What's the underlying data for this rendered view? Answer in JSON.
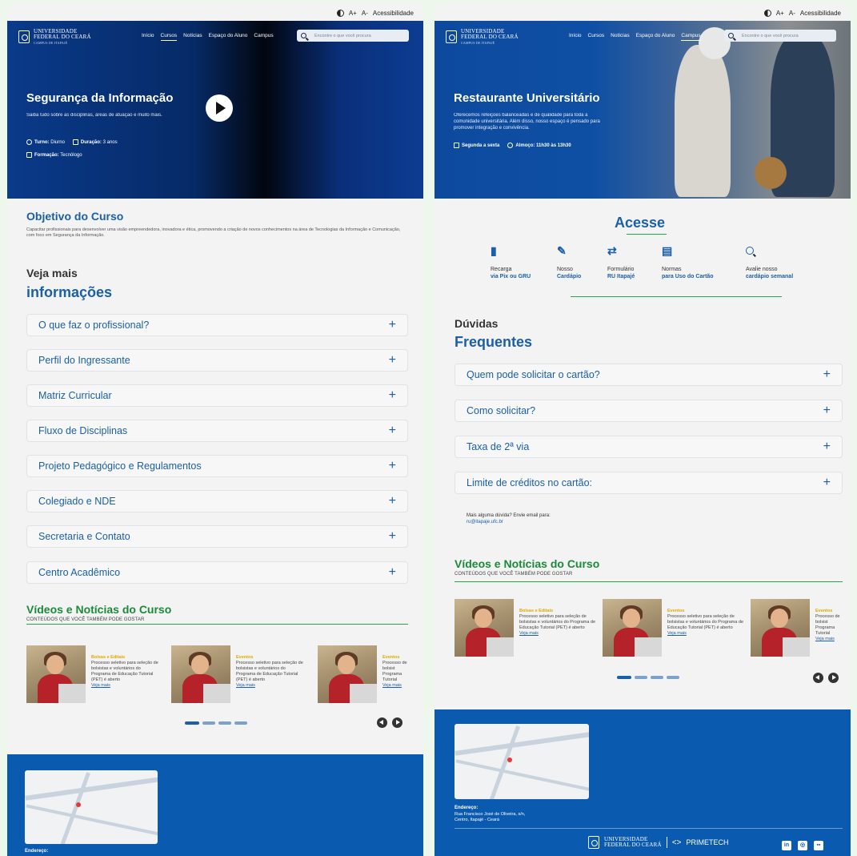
{
  "topbar": {
    "a_plus": "A+",
    "a_minus": "A-",
    "accessibility": "Acessibilidade"
  },
  "logo": {
    "line1": "UNIVERSIDADE",
    "line2": "FEDERAL DO CEARÁ",
    "sub": "CAMPUS DE ITAPAJÉ"
  },
  "nav": {
    "items": [
      "Início",
      "Cursos",
      "Notícias",
      "Espaço do Aluno",
      "Campus"
    ]
  },
  "search": {
    "placeholder": "Encontre o que você procura"
  },
  "left": {
    "hero": {
      "title": "Segurança da Informação",
      "desc": "Saiba tudo sobre as disciplinas, áreas de atuação e muito mais.",
      "turno_label": "Turno:",
      "turno_value": "Diurno",
      "duracao_label": "Duração:",
      "duracao_value": "3 anos",
      "formacao_label": "Formação:",
      "formacao_value": "Tecnólogo"
    },
    "objetivo": {
      "title": "Objetivo do Curso",
      "text": "Capacitar profissionais para desenvolver uma visão empreendedora, inovadora e ética, promovendo a criação de novos conhecimentos na área de Tecnologias da Informação e Comunicação, com foco em Segurança da Informação."
    },
    "veja": {
      "line1": "Veja mais",
      "line2": "informações"
    },
    "accordion": [
      "O que faz o profissional?",
      "Perfil do Ingressante",
      "Matriz Curricular",
      "Fluxo de Disciplinas",
      "Projeto Pedagógico e Regulamentos",
      "Colegiado e NDE",
      "Secretaria e Contato",
      "Centro Acadêmico"
    ]
  },
  "right": {
    "hero": {
      "title": "Restaurante Universitário",
      "desc": "Oferecemos refeições balanceadas e de qualidade para toda a comunidade universitária. Além disso, nosso espaço é pensado para promover integração e convivência.",
      "days": "Segunda a sexta",
      "lunch": "Almoço: 11h30 às 13h30"
    },
    "acesse": {
      "title": "Acesse",
      "items": [
        {
          "icon": "book-reader-icon",
          "glyph": "▮",
          "line1": "Recarga",
          "line2": "via Pix ou GRU"
        },
        {
          "icon": "edit-icon",
          "glyph": "✎",
          "line1": "Nosso",
          "line2": "Cardápio"
        },
        {
          "icon": "swap-arrows-icon",
          "glyph": "⇄",
          "line1": "Formulário",
          "line2": "RU Itapajé"
        },
        {
          "icon": "guidelines-icon",
          "glyph": "▤",
          "line1": "Normas",
          "line2": "para Uso do Cartão"
        },
        {
          "icon": "search-icon",
          "glyph": "",
          "line1": "Avalie nosso",
          "line2": "cardápio semanal"
        }
      ]
    },
    "duvidas": {
      "line1": "Dúvidas",
      "line2": "Frequentes"
    },
    "accordion": [
      "Quem pode solicitar o cartão?",
      "Como solicitar?",
      "Taxa de 2ª via",
      "Limite de créditos no cartão:"
    ],
    "mais": {
      "text": "Mais alguma dúvida?  Envie email para:",
      "email": "ru@itapaje.ufc.br"
    }
  },
  "news": {
    "title": "Vídeos e Notícias do Curso",
    "subtitle": "CONTEÚDOS QUE VOCÊ TAMBÉM PODE GOSTAR",
    "cards": [
      {
        "category": "Bolsas e Editais",
        "text": "Processo seletivo para seleção de bolsistas e voluntários do Programa de Educação Tutorial (PET) é aberto",
        "link": "Veja mais"
      },
      {
        "category": "Eventos",
        "text": "Processo seletivo para seleção de bolsistas e voluntários do Programa de Educação Tutorial (PET) é aberto",
        "link": "Veja mais"
      },
      {
        "category": "Eventos",
        "text": "Processo de bolsist Programa Tutorial",
        "link": "Veja mais"
      }
    ]
  },
  "footer": {
    "address_label": "Endereço:",
    "address_line1": "Rua Francisco José de Oliveira, s/n,",
    "address_line2": "Centro, Itapajé - Ceará",
    "partner": "PRIMETECH",
    "social": [
      "in",
      "◎",
      "▪▪"
    ]
  },
  "colors": {
    "primary": "#1a5fa8",
    "green": "#2aa34f",
    "footer": "#0a5ab0",
    "category": "#e0a800"
  }
}
